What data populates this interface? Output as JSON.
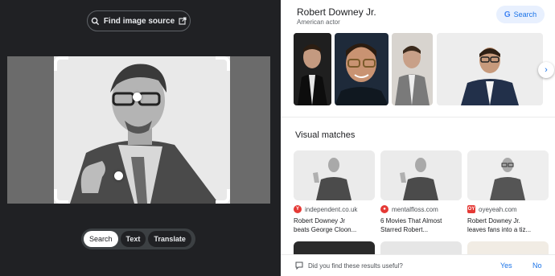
{
  "left_panel": {
    "find_source_label": "Find image source",
    "modes": [
      {
        "label": "Search",
        "active": true
      },
      {
        "label": "Text",
        "active": false
      },
      {
        "label": "Translate",
        "active": false
      }
    ]
  },
  "knowledge_panel": {
    "title": "Robert Downey Jr.",
    "subtitle": "American actor",
    "search_label": "Search"
  },
  "visual_matches": {
    "heading": "Visual matches",
    "cards": [
      {
        "source": "independent.co.uk",
        "favicon": "Y",
        "favicon_color": "#e53935",
        "caption_1": "Robert Downey Jr",
        "caption_2": "beats George Cloon..."
      },
      {
        "source": "mentalfloss.com",
        "favicon": "●",
        "favicon_color": "#e53935",
        "caption_1": "6 Movies That Almost",
        "caption_2": "Starred Robert..."
      },
      {
        "source": "oyeyeah.com",
        "favicon": "OY",
        "favicon_color": "#e53935",
        "caption_1": "Robert Downey Jr.",
        "caption_2": "leaves fans into a tiz..."
      }
    ]
  },
  "feedback": {
    "question": "Did you find these results useful?",
    "yes": "Yes",
    "no": "No"
  }
}
